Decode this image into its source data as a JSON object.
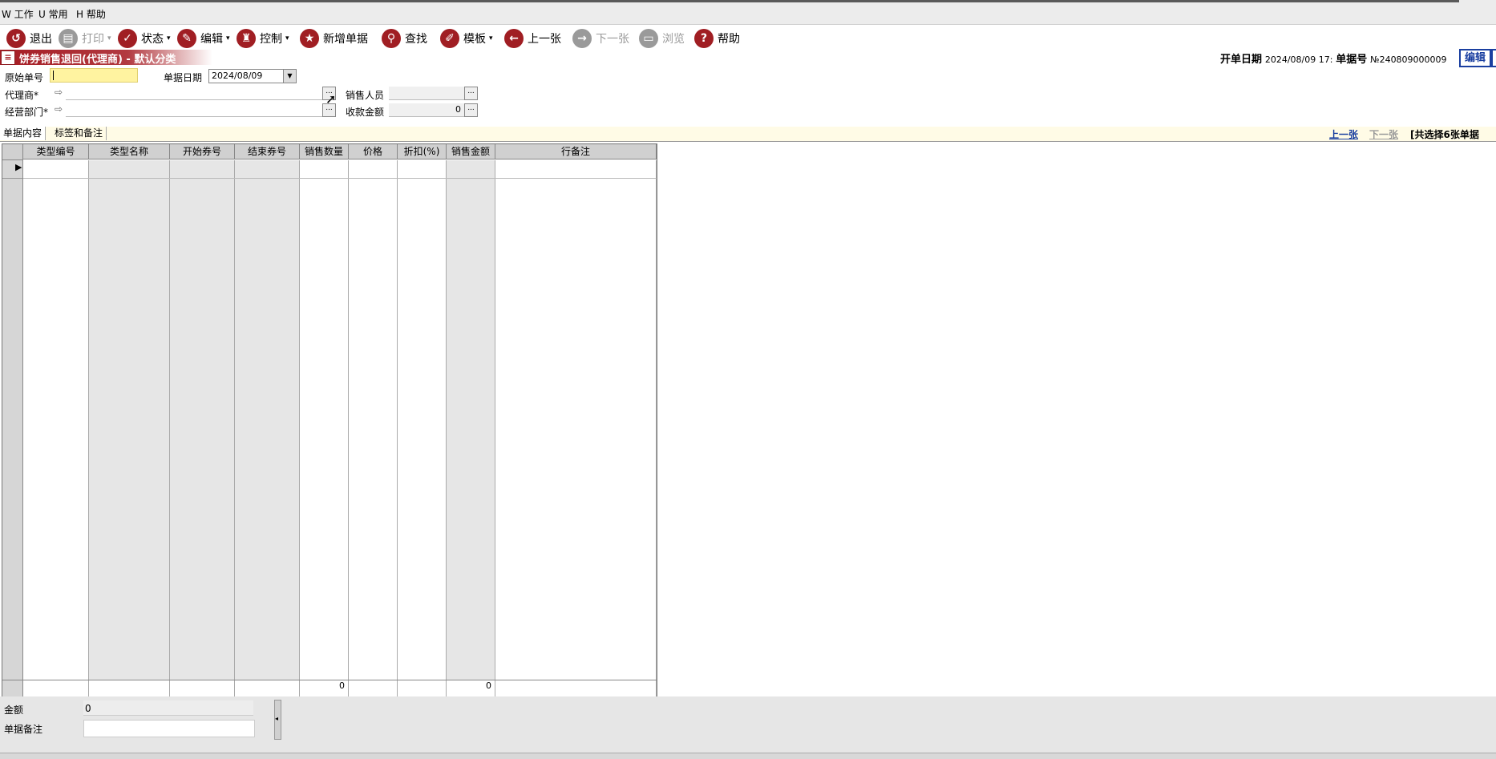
{
  "menu": {
    "items": [
      "W 工作",
      "U 常用",
      "H 帮助"
    ]
  },
  "toolbar": {
    "exit": "退出",
    "print": "打印",
    "status": "状态",
    "edit": "编辑",
    "control": "控制",
    "new_doc": "新增单据",
    "find": "查找",
    "template": "模板",
    "prev": "上一张",
    "next": "下一张",
    "browse": "浏览",
    "help": "帮助",
    "dropdown_arrow": "▾"
  },
  "title": "饼券销售退回(代理商) - 默认分类",
  "header_right": {
    "open_date_label": "开单日期",
    "open_date_value": "2024/08/09 17:",
    "doc_no_label": "单据号",
    "doc_no_value": "№240809000009",
    "edit_button": "编辑"
  },
  "form": {
    "orig_no_label": "原始单号",
    "orig_no_value": "",
    "doc_date_label": "单据日期",
    "doc_date_value": "2024/08/09",
    "agent_label": "代理商*",
    "agent_value": "",
    "salesperson_label": "销售人员",
    "salesperson_value": "",
    "dept_label": "经营部门*",
    "dept_value": "",
    "amount_label": "收款金额",
    "amount_value": "0",
    "ellipsis": "...",
    "date_arrow": "▼",
    "link_arrow": "⇨"
  },
  "tabs": {
    "content": "单据内容",
    "tags": "标签和备注"
  },
  "nav": {
    "prev": "上一张",
    "next": "下一张",
    "total": "[共选择6张单据"
  },
  "grid": {
    "columns": [
      "类型编号",
      "类型名称",
      "开始券号",
      "结束券号",
      "销售数量",
      "价格",
      "折扣(%)",
      "销售金额",
      "行备注"
    ],
    "row_marker": "▶",
    "totals": {
      "qty": "0",
      "amount": "0"
    }
  },
  "bottom": {
    "amount_label": "金额",
    "amount_value": "0",
    "remark_label": "单据备注",
    "remark_value": ""
  }
}
